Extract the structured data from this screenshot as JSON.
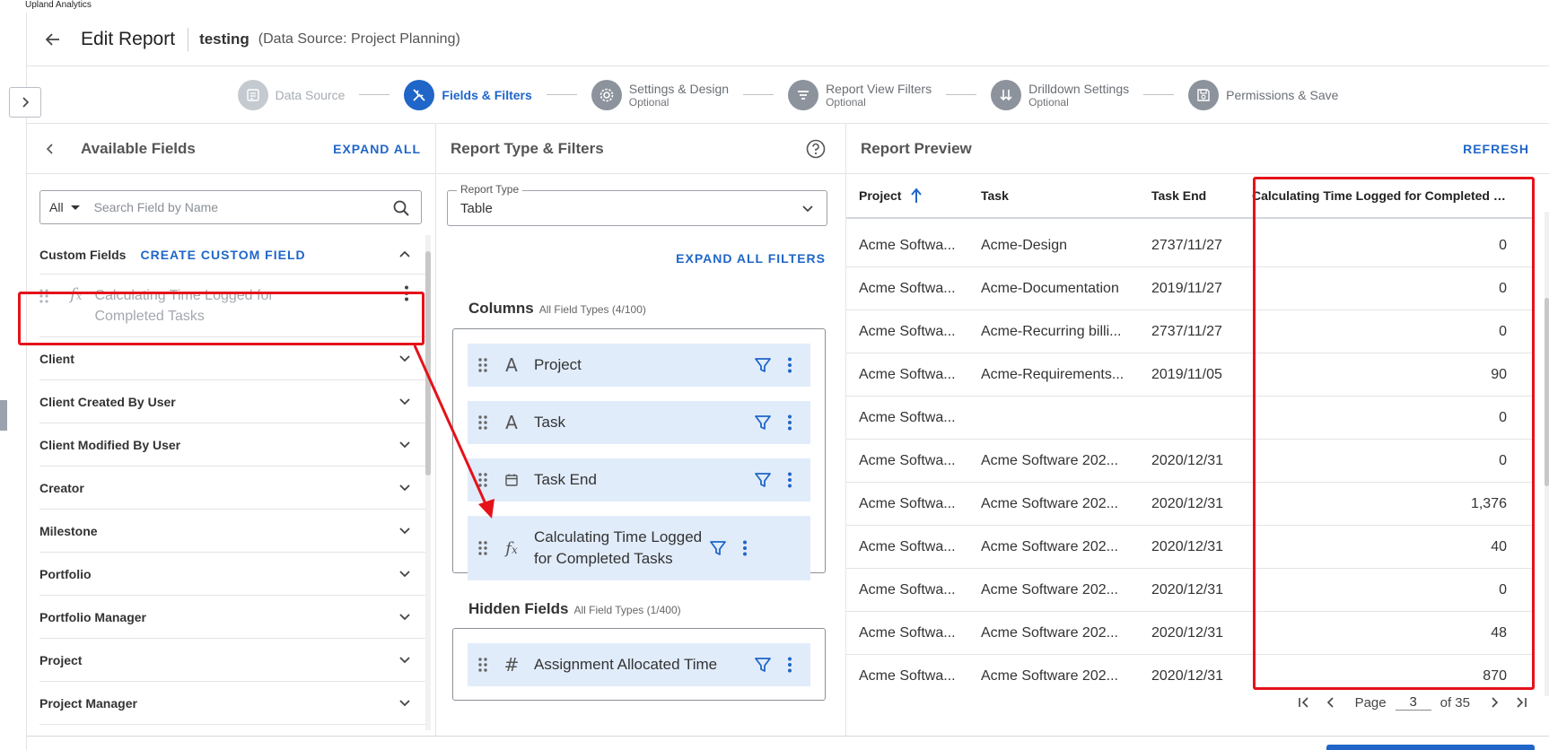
{
  "app": {
    "name": "Upland Analytics"
  },
  "header": {
    "title": "Edit Report",
    "report_name": "testing",
    "data_source_label": "(Data Source: Project Planning)"
  },
  "steps": [
    {
      "label": "Data Source",
      "sub": "",
      "state": "disabled",
      "icon": "document-icon"
    },
    {
      "label": "Fields & Filters",
      "sub": "",
      "state": "active",
      "icon": "tools-icon"
    },
    {
      "label": "Settings & Design",
      "sub": "Optional",
      "state": "normal",
      "icon": "gear-icon"
    },
    {
      "label": "Report View Filters",
      "sub": "Optional",
      "state": "normal",
      "icon": "filter-lines-icon"
    },
    {
      "label": "Drilldown Settings",
      "sub": "Optional",
      "state": "normal",
      "icon": "drilldown-icon"
    },
    {
      "label": "Permissions & Save",
      "sub": "",
      "state": "normal",
      "icon": "save-icon"
    }
  ],
  "available_fields": {
    "title": "Available Fields",
    "expand_all": "EXPAND ALL",
    "search_scope": "All",
    "search_placeholder": "Search Field by Name",
    "custom_fields_title": "Custom Fields",
    "create_custom_field": "CREATE CUSTOM FIELD",
    "custom_field_item": "Calculating Time Logged for Completed Tasks",
    "groups": [
      "Client",
      "Client Created By User",
      "Client Modified By User",
      "Creator",
      "Milestone",
      "Portfolio",
      "Portfolio Manager",
      "Project",
      "Project Manager"
    ]
  },
  "report_type_filters": {
    "title": "Report Type & Filters",
    "report_type_legend": "Report Type",
    "report_type_value": "Table",
    "expand_all_filters": "EXPAND ALL FILTERS",
    "columns_title": "Columns",
    "columns_sub": "All Field Types (4/100)",
    "columns": [
      {
        "label": "Project",
        "type_icon": "text-type-icon"
      },
      {
        "label": "Task",
        "type_icon": "text-type-icon"
      },
      {
        "label": "Task End",
        "type_icon": "calendar-icon"
      },
      {
        "label": "Calculating Time Logged for Completed Tasks",
        "type_icon": "function-icon"
      }
    ],
    "hidden_title": "Hidden Fields",
    "hidden_sub": "All Field Types (1/400)",
    "hidden_fields": [
      {
        "label": "Assignment Allocated Time",
        "type_icon": "number-type-icon"
      }
    ]
  },
  "report_preview": {
    "title": "Report Preview",
    "refresh": "REFRESH",
    "columns": [
      "Project",
      "Task",
      "Task End",
      "Calculating Time Logged for Completed Ta..."
    ],
    "rows": [
      [
        "Acme Softwa...",
        "Acme-Design",
        "2737/11/27",
        "0"
      ],
      [
        "Acme Softwa...",
        "Acme-Documentation",
        "2019/11/27",
        "0"
      ],
      [
        "Acme Softwa...",
        "Acme-Recurring billi...",
        "2737/11/27",
        "0"
      ],
      [
        "Acme Softwa...",
        "Acme-Requirements...",
        "2019/11/05",
        "90"
      ],
      [
        "Acme Softwa...",
        "",
        "",
        "0"
      ],
      [
        "Acme Softwa...",
        "Acme Software 202...",
        "2020/12/31",
        "0"
      ],
      [
        "Acme Softwa...",
        "Acme Software 202...",
        "2020/12/31",
        "1,376"
      ],
      [
        "Acme Softwa...",
        "Acme Software 202...",
        "2020/12/31",
        "40"
      ],
      [
        "Acme Softwa...",
        "Acme Software 202...",
        "2020/12/31",
        "0"
      ],
      [
        "Acme Softwa...",
        "Acme Software 202...",
        "2020/12/31",
        "48"
      ],
      [
        "Acme Softwa...",
        "Acme Software 202...",
        "2020/12/31",
        "870"
      ]
    ],
    "pager": {
      "page_label": "Page",
      "page_value": "3",
      "of_label": "of 35"
    }
  },
  "colors": {
    "accent": "#1f66c8",
    "highlight": "#e5121a",
    "column_item_bg": "#e1ecfb"
  }
}
